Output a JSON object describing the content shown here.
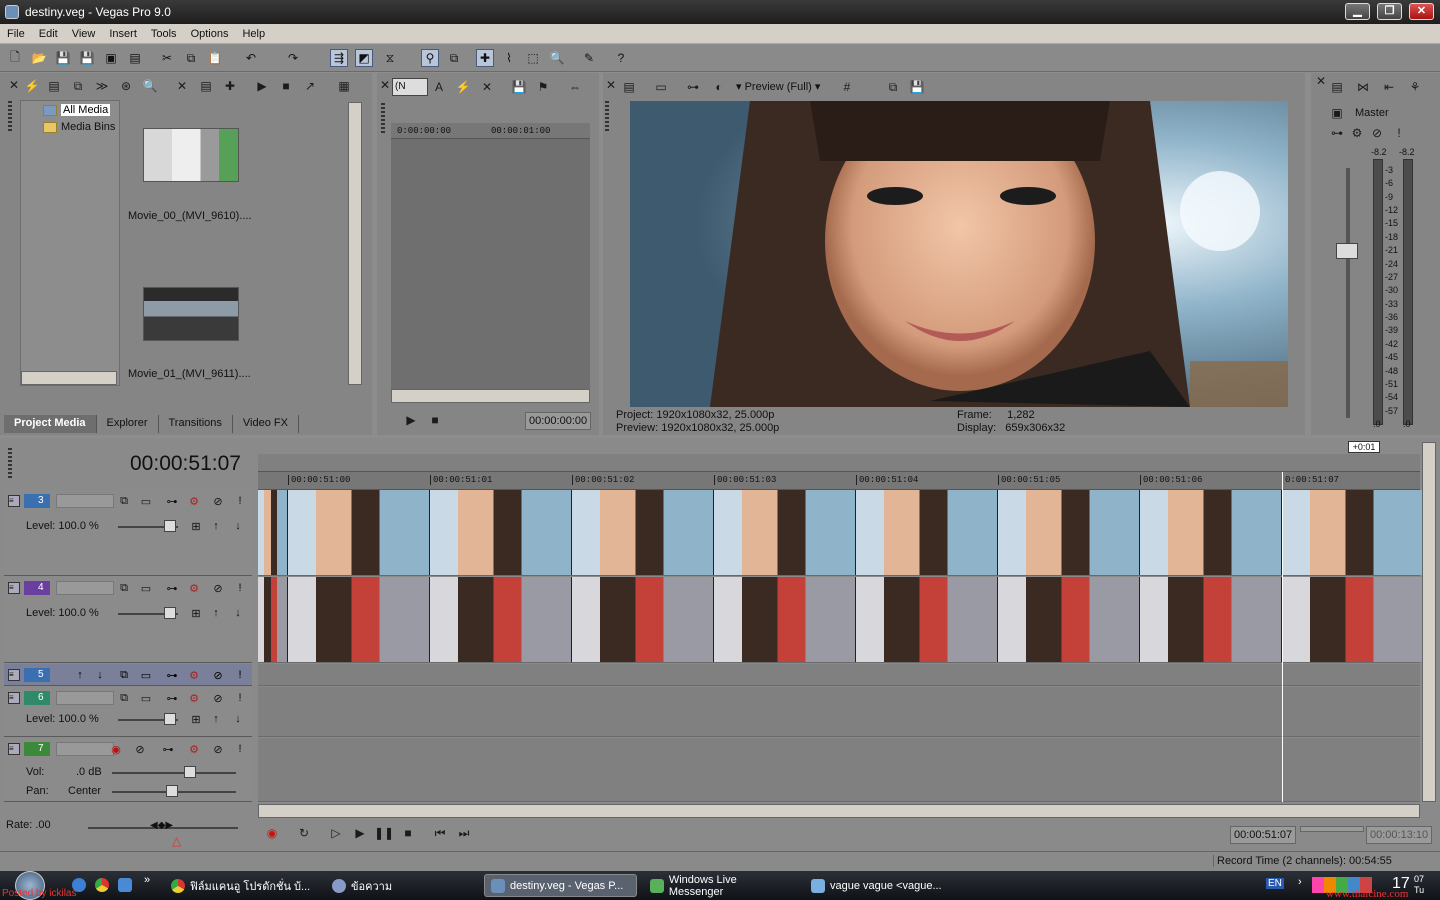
{
  "window": {
    "title": "destiny.veg - Vegas Pro 9.0",
    "minimize": "▁",
    "restore": "❐",
    "close": "✕"
  },
  "menu": [
    "File",
    "Edit",
    "View",
    "Insert",
    "Tools",
    "Options",
    "Help"
  ],
  "media_tree": {
    "items": [
      "All Media",
      "Media Bins"
    ]
  },
  "media_files": [
    {
      "name": "Movie_00_(MVI_9610)...."
    },
    {
      "name": "Movie_01_(MVI_9611)...."
    }
  ],
  "tabs": [
    "Project Media",
    "Explorer",
    "Transitions",
    "Video FX"
  ],
  "trimmer": {
    "ruler_start": "0:00:00:00",
    "ruler_mark": "00:00:01:00",
    "timecode": "00:00:00:00",
    "dropdown": "(N"
  },
  "preview": {
    "mode_label": "Preview (Full)",
    "project_label": "Project:",
    "project_value": "1920x1080x32, 25.000p",
    "preview_label": "Preview:",
    "preview_value": "1920x1080x32, 25.000p",
    "frame_label": "Frame:",
    "frame_value": "1,282",
    "display_label": "Display:",
    "display_value": "659x306x32"
  },
  "mixer": {
    "master_label": "Master",
    "peak_left": "-8.2",
    "peak_right": "-8.2",
    "scale": [
      "3",
      "6",
      "9",
      "12",
      "15",
      "18",
      "21",
      "24",
      "27",
      "30",
      "33",
      "36",
      "39",
      "42",
      "45",
      "48",
      "51",
      "54",
      "57"
    ],
    "bottom_left": ".0",
    "bottom_right": ".0"
  },
  "timeline": {
    "cursor": "00:00:51:07",
    "offset": "+0:01",
    "ticks": [
      "00:00:51:00",
      "00:00:51:01",
      "00:00:51:02",
      "00:00:51:03",
      "00:00:51:04",
      "00:00:51:05",
      "00:00:51:06",
      "0:00:51:07"
    ]
  },
  "tracks": [
    {
      "num": "3",
      "level_label": "Level: 100.0 %",
      "color": "#3a6fb0"
    },
    {
      "num": "4",
      "level_label": "Level: 100.0 %",
      "color": "#6a3fa0"
    },
    {
      "num": "5",
      "level_label": "",
      "color": "#3a6fb0"
    },
    {
      "num": "6",
      "level_label": "Level: 100.0 %",
      "color": "#2f8a6a"
    },
    {
      "num": "7",
      "vol_label": "Vol:",
      "vol_value": ".0 dB",
      "pan_label": "Pan:",
      "pan_value": "Center",
      "color": "#3a8a3a"
    }
  ],
  "transport": {
    "rate": "Rate: .00",
    "time_current": "00:00:51:07",
    "time_length": "00:00:13:10"
  },
  "status": {
    "record_time": "Record Time (2 channels): 00:54:55"
  },
  "taskbar": {
    "tasks": [
      "ฟิล์มแคนอู โปรดักชั่น บ้...",
      "ข้อความ",
      "destiny.veg - Vegas P...",
      "Windows Live Messenger",
      "vague vague <vague..."
    ],
    "lang": "EN",
    "clock": "17",
    "clock_small": "07",
    "clock_day": "Tu",
    "watermark_left": "Posted by ickilas",
    "watermark_right": "www.thaicine.com"
  }
}
